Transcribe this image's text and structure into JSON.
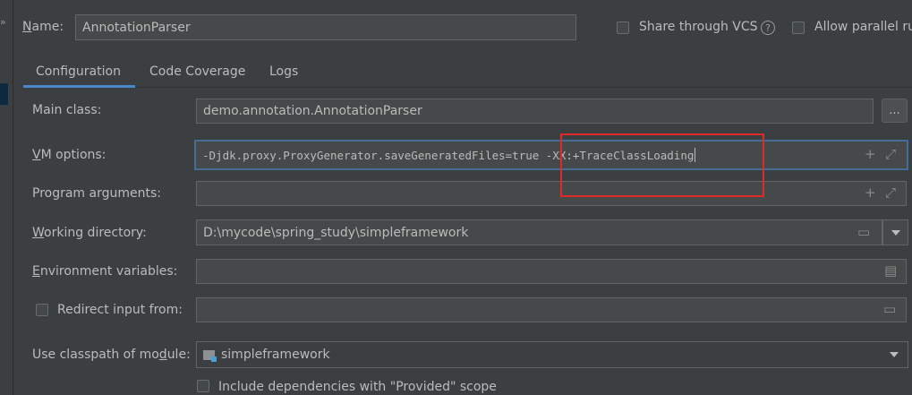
{
  "header": {
    "name_label": "Name:",
    "name_value": "AnnotationParser",
    "share_vcs_label": "Share through VCS",
    "allow_parallel_label": "Allow parallel ru"
  },
  "tabs": [
    {
      "label": "Configuration",
      "active": true
    },
    {
      "label": "Code Coverage",
      "active": false
    },
    {
      "label": "Logs",
      "active": false
    }
  ],
  "form": {
    "main_class_label": "Main class:",
    "main_class_value": "demo.annotation.AnnotationParser",
    "main_class_button": "...",
    "vm_options_label": "VM options:",
    "vm_options_value": "-Djdk.proxy.ProxyGenerator.saveGeneratedFiles=true -XX:+TraceClassLoading",
    "program_args_label": "Program arguments:",
    "program_args_value": "",
    "working_dir_label": "Working directory:",
    "working_dir_value": "D:\\mycode\\spring_study\\simpleframework",
    "env_vars_label": "Environment variables:",
    "env_vars_value": "",
    "redirect_label": "Redirect input from:",
    "redirect_value": "",
    "classpath_label": "Use classpath of module:",
    "classpath_value": "simpleframework",
    "include_deps_label": "Include dependencies with \"Provided\" scope"
  },
  "colors": {
    "background": "#3c3f41",
    "field": "#45494a",
    "focus_border": "#466d94",
    "tab_underline": "#4a88c7",
    "highlight_box": "#e02a2a"
  }
}
